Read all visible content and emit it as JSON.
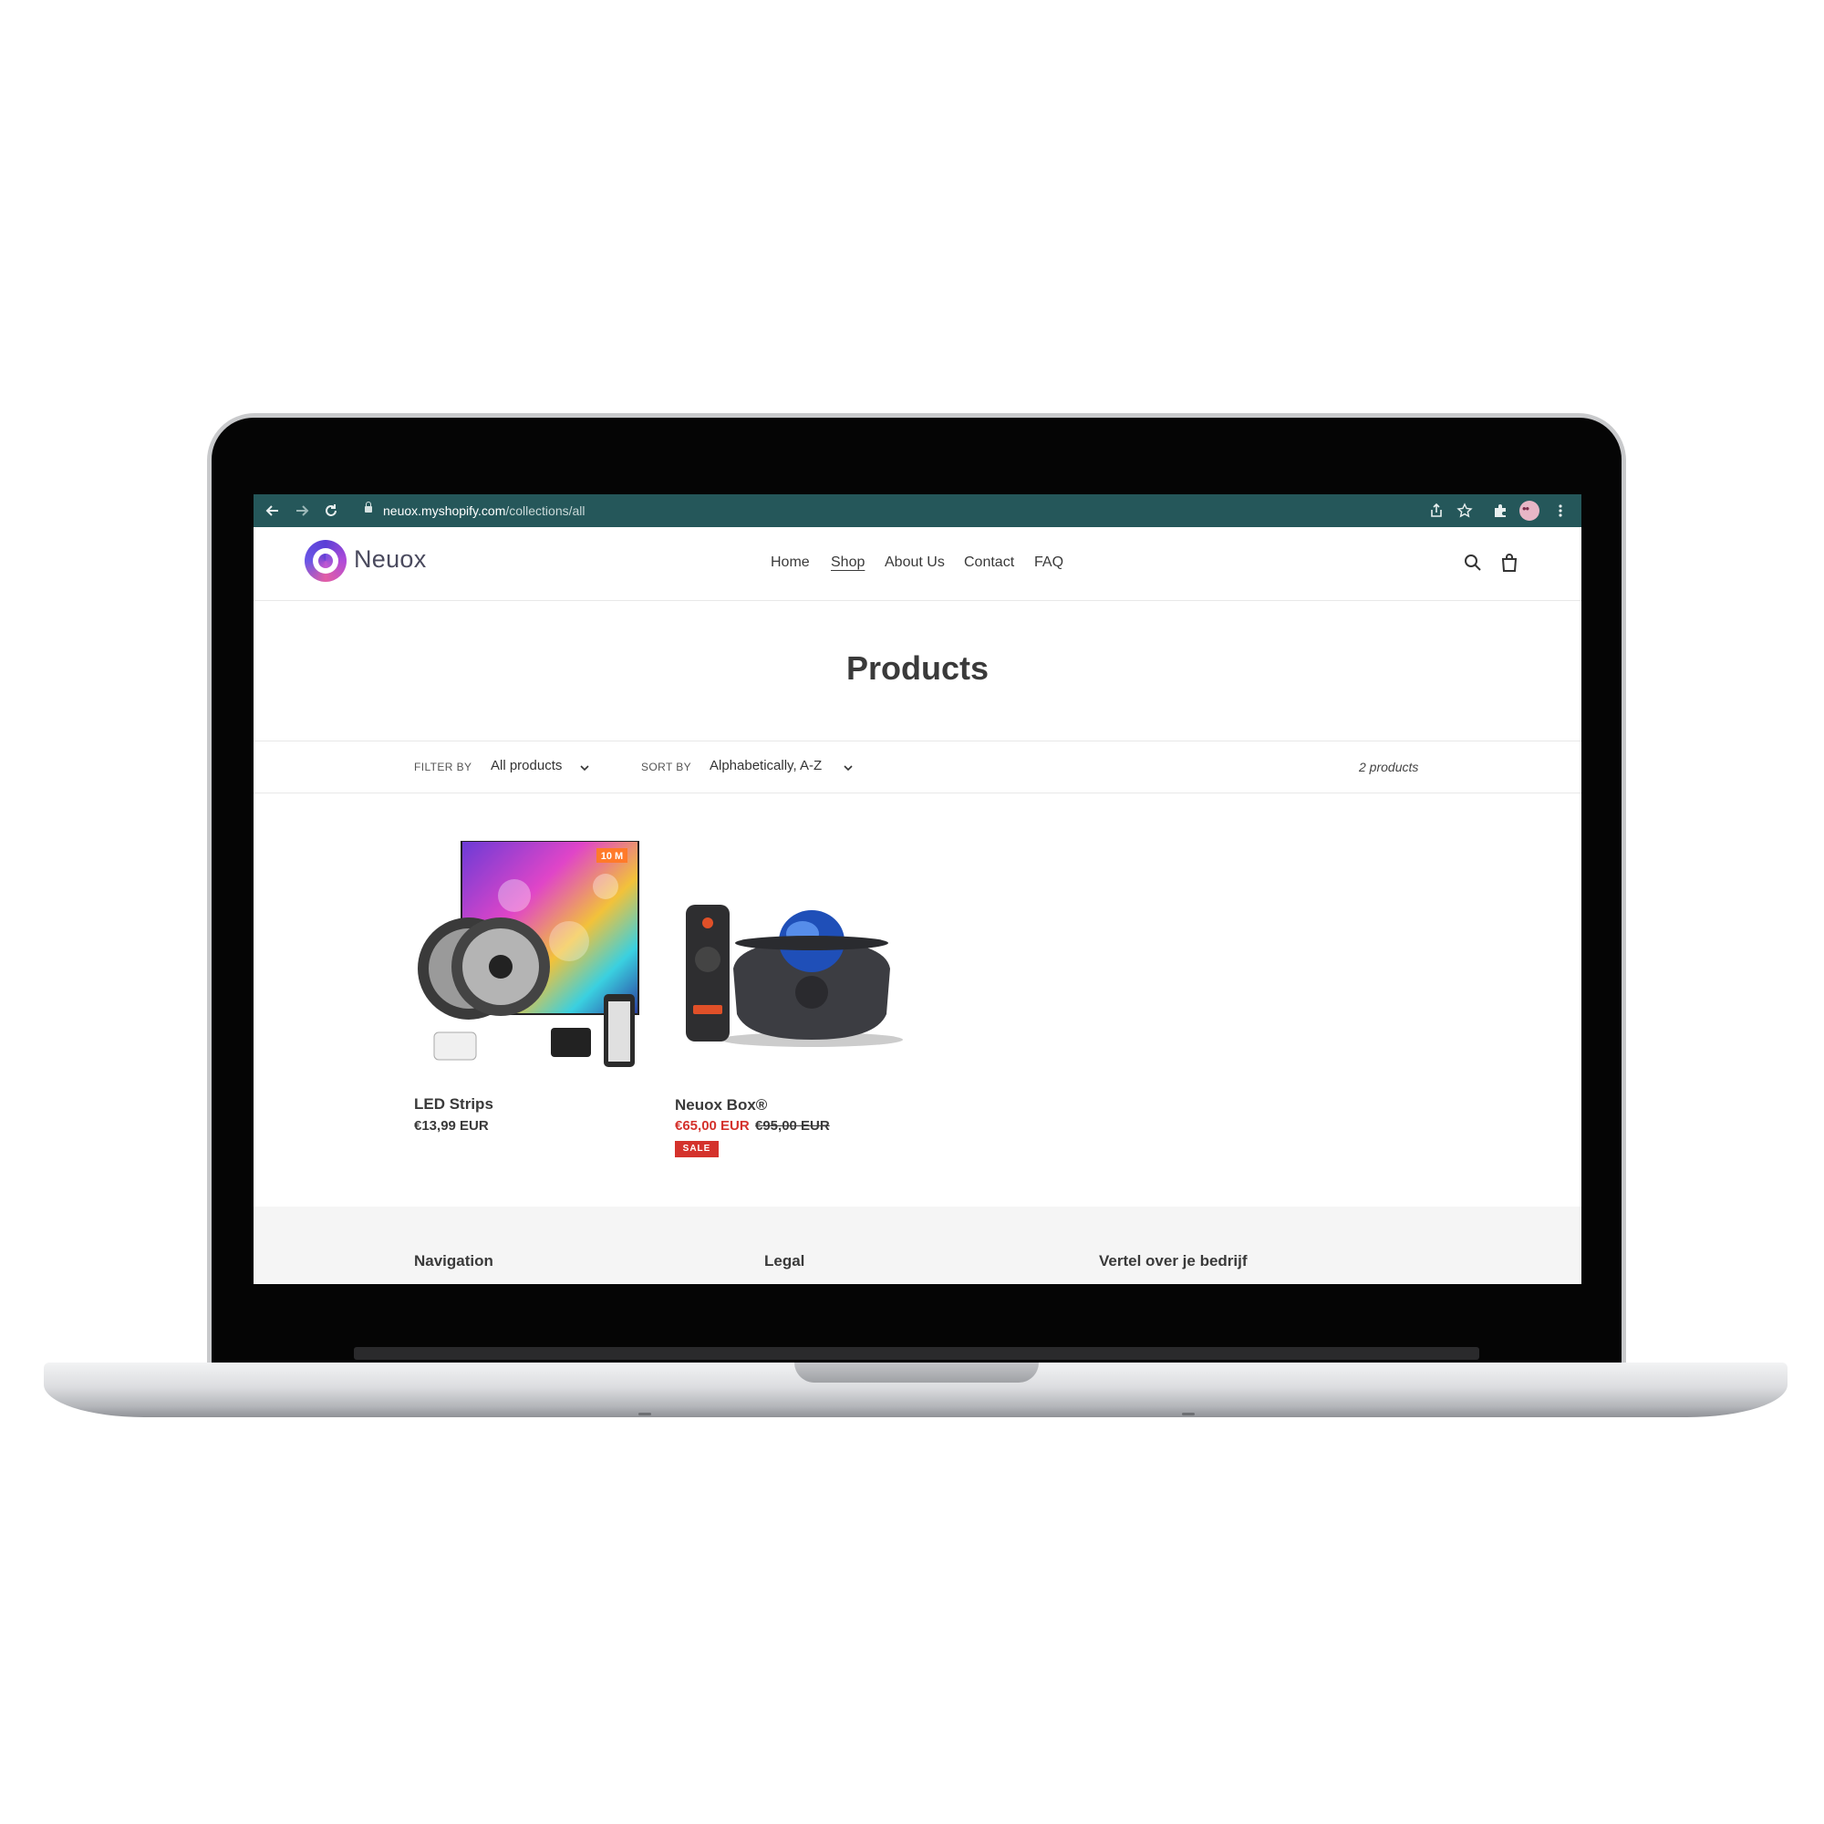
{
  "browser": {
    "url_host": "neuox.myshopify.com",
    "url_path": "/collections/all",
    "toolbar_color": "#25575a"
  },
  "header": {
    "logo_text": "Neuox",
    "nav": [
      "Home",
      "Shop",
      "About Us",
      "Contact",
      "FAQ"
    ],
    "active_nav": "Shop"
  },
  "page": {
    "title": "Products"
  },
  "filters": {
    "filter_label": "FILTER BY",
    "filter_value": "All products",
    "sort_label": "SORT BY",
    "sort_value": "Alphabetically, A-Z",
    "count": "2 products"
  },
  "products": [
    {
      "title": "LED Strips",
      "price": "€13,99 EUR",
      "badge_text": "10 M"
    },
    {
      "title": "Neuox Box®",
      "sale_price": "€65,00 EUR",
      "compare_price": "€95,00 EUR",
      "badge": "SALE"
    }
  ],
  "footer": {
    "columns": [
      "Navigation",
      "Legal",
      "Vertel over je bedrijf"
    ]
  },
  "colors": {
    "sale": "#d4322c",
    "accent": "#25575a"
  }
}
